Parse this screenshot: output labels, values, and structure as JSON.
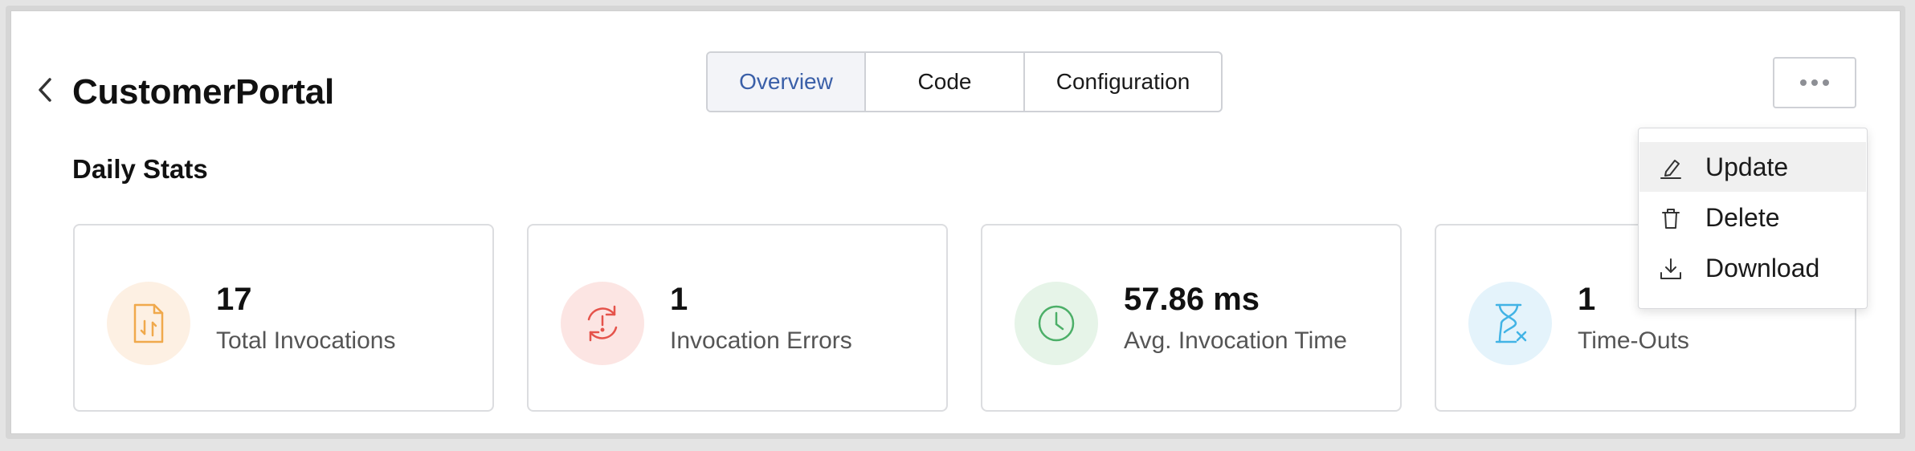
{
  "header": {
    "title": "CustomerPortal",
    "back_icon": "chevron-left-icon"
  },
  "tabs": [
    {
      "label": "Overview",
      "active": true
    },
    {
      "label": "Code",
      "active": false
    },
    {
      "label": "Configuration",
      "active": false
    }
  ],
  "more_button": {
    "icon": "more-horizontal-icon"
  },
  "section": {
    "title": "Daily Stats"
  },
  "stats": [
    {
      "value": "17",
      "label": "Total Invocations",
      "icon": "file-transfer-icon",
      "color": "#f0a94c"
    },
    {
      "value": "1",
      "label": "Invocation Errors",
      "icon": "error-refresh-icon",
      "color": "#e5534b"
    },
    {
      "value": "57.86 ms",
      "label": "Avg. Invocation Time",
      "icon": "clock-icon",
      "color": "#4caf68"
    },
    {
      "value": "1",
      "label": "Time-Outs",
      "icon": "hourglass-x-icon",
      "color": "#42b3e5"
    }
  ],
  "menu": {
    "items": [
      {
        "label": "Update",
        "icon": "edit-icon",
        "hovered": true
      },
      {
        "label": "Delete",
        "icon": "trash-icon",
        "hovered": false
      },
      {
        "label": "Download",
        "icon": "download-icon",
        "hovered": false
      }
    ]
  },
  "colors": {
    "accent": "#3a5fa8",
    "active_tab_bg": "#f3f4f8"
  }
}
